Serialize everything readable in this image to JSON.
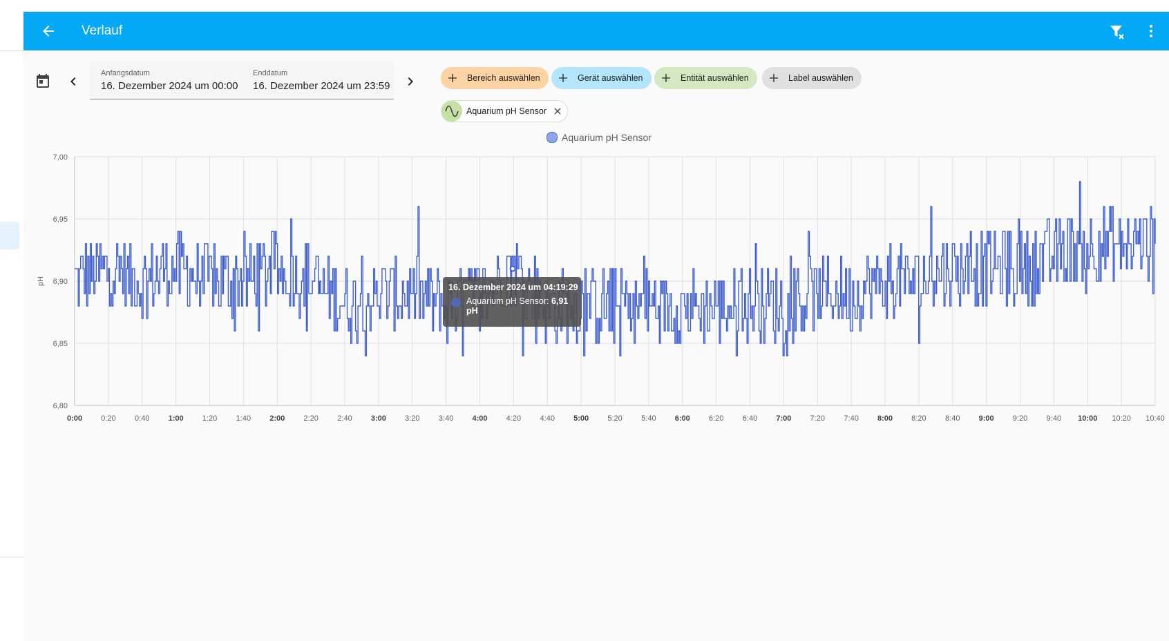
{
  "app": {
    "title": "Verlauf",
    "accent_color": "#03a9f4"
  },
  "icons": {
    "back": "arrow-left-icon",
    "filter_clear": "filter-remove-icon",
    "menu": "dots-vertical-icon",
    "calendar": "calendar-icon",
    "prev": "chevron-left-icon",
    "next": "chevron-right-icon"
  },
  "date_range": {
    "start_label": "Anfangsdatum",
    "start_value": "16. Dezember 2024 um 00:00",
    "end_label": "Enddatum",
    "end_value": "16. Dezember 2024 um 23:59"
  },
  "target_chips": [
    {
      "label": "Bereich auswählen",
      "color": "#fdd3a4"
    },
    {
      "label": "Gerät auswählen",
      "color": "#b3e5fc"
    },
    {
      "label": "Entität auswählen",
      "color": "#d4e8c2"
    },
    {
      "label": "Label auswählen",
      "color": "#e0e0e0"
    }
  ],
  "selected_entity": {
    "label": "Aquarium pH Sensor",
    "icon": "sine-wave-icon"
  },
  "tooltip": {
    "title": "16. Dezember 2024 um 04:19:29",
    "series": "Aquarium pH Sensor:",
    "value": "6,91",
    "unit": "pH"
  },
  "chart_data": {
    "type": "line",
    "step": true,
    "legend": [
      "Aquarium pH Sensor"
    ],
    "legend_position": "top-center",
    "series_color": "#3f5fd0",
    "ylabel": "pH",
    "ylim": [
      6.8,
      7.0
    ],
    "y_ticks": [
      "6,80",
      "6,85",
      "6,90",
      "6,95",
      "7,00"
    ],
    "x_ticks": [
      "0:00",
      "0:20",
      "0:40",
      "1:00",
      "1:20",
      "1:40",
      "2:00",
      "2:20",
      "2:40",
      "3:00",
      "3:20",
      "3:40",
      "4:00",
      "4:20",
      "4:40",
      "5:00",
      "5:20",
      "5:40",
      "6:00",
      "6:20",
      "6:40",
      "7:00",
      "7:20",
      "7:40",
      "8:00",
      "8:20",
      "8:40",
      "9:00",
      "9:20",
      "9:40",
      "10:00",
      "10:20",
      "10:40"
    ],
    "x_ticks_bold": [
      "0:00",
      "1:00",
      "2:00",
      "3:00",
      "4:00",
      "5:00",
      "6:00",
      "7:00",
      "8:00",
      "9:00",
      "10:00"
    ],
    "grid": true,
    "series": [
      {
        "name": "Aquarium pH Sensor",
        "x": [
          "0:00",
          "0:20",
          "0:40",
          "1:00",
          "1:20",
          "1:40",
          "2:00",
          "2:20",
          "2:40",
          "3:00",
          "3:20",
          "3:40",
          "4:00",
          "4:20",
          "4:40",
          "5:00",
          "5:20",
          "5:40",
          "6:00",
          "6:20",
          "6:40",
          "7:00",
          "7:20",
          "7:40",
          "8:00",
          "8:20",
          "8:40",
          "9:00",
          "9:20",
          "9:40",
          "10:00",
          "10:20",
          "10:40"
        ],
        "values": [
          6.9,
          6.91,
          6.9,
          6.91,
          6.9,
          6.9,
          6.91,
          6.9,
          6.88,
          6.89,
          6.89,
          6.88,
          6.89,
          6.91,
          6.88,
          6.88,
          6.88,
          6.88,
          6.88,
          6.88,
          6.88,
          6.88,
          6.89,
          6.89,
          6.9,
          6.9,
          6.91,
          6.91,
          6.91,
          6.92,
          6.93,
          6.93,
          6.93
        ]
      }
    ],
    "highlight_point": {
      "x": "4:19:29",
      "y": 6.91
    }
  }
}
